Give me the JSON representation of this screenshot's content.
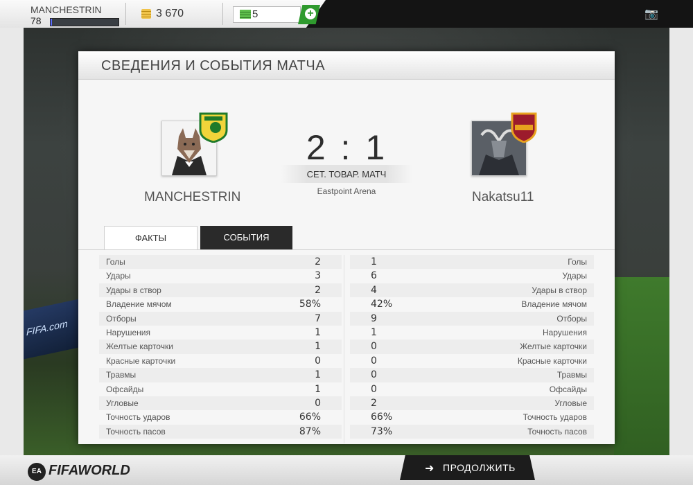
{
  "topbar": {
    "username": "MANCHESTRIN",
    "level": "78",
    "xp_progress": 0.02,
    "coins": "3 670",
    "cash": "5",
    "add_label": "+"
  },
  "panel": {
    "title": "СВЕДЕНИЯ И СОБЫТИЯ МАТЧА",
    "home_team": "MANCHESTRIN",
    "away_team": "Nakatsu11",
    "score": "2 : 1",
    "match_type": "СЕТ. ТОВАР. МАТЧ",
    "venue": "Eastpoint Arena",
    "tabs": {
      "facts": "ФАКТЫ",
      "events": "СОБЫТИЯ"
    }
  },
  "stats": [
    {
      "label": "Голы",
      "home": "2",
      "away": "1"
    },
    {
      "label": "Удары",
      "home": "3",
      "away": "6"
    },
    {
      "label": "Удары в створ",
      "home": "2",
      "away": "4"
    },
    {
      "label": "Владение мячом",
      "home": "58%",
      "away": "42%"
    },
    {
      "label": "Отборы",
      "home": "7",
      "away": "9"
    },
    {
      "label": "Нарушения",
      "home": "1",
      "away": "1"
    },
    {
      "label": "Желтые карточки",
      "home": "1",
      "away": "0"
    },
    {
      "label": "Красные карточки",
      "home": "0",
      "away": "0"
    },
    {
      "label": "Травмы",
      "home": "1",
      "away": "0"
    },
    {
      "label": "Офсайды",
      "home": "1",
      "away": "0"
    },
    {
      "label": "Угловые",
      "home": "0",
      "away": "2"
    },
    {
      "label": "Точность ударов",
      "home": "66%",
      "away": "66%"
    },
    {
      "label": "Точность пасов",
      "home": "87%",
      "away": "73%"
    }
  ],
  "footer": {
    "logo_badge": "EA",
    "logo_text": "FIFAWORLD",
    "continue_label": "ПРОДОЛЖИТЬ"
  },
  "background": {
    "ad_text": "FIFA.com"
  },
  "colors": {
    "accent_green": "#2f9a2e",
    "dark": "#1c1c1c",
    "xp_blue": "#5a6cff"
  }
}
